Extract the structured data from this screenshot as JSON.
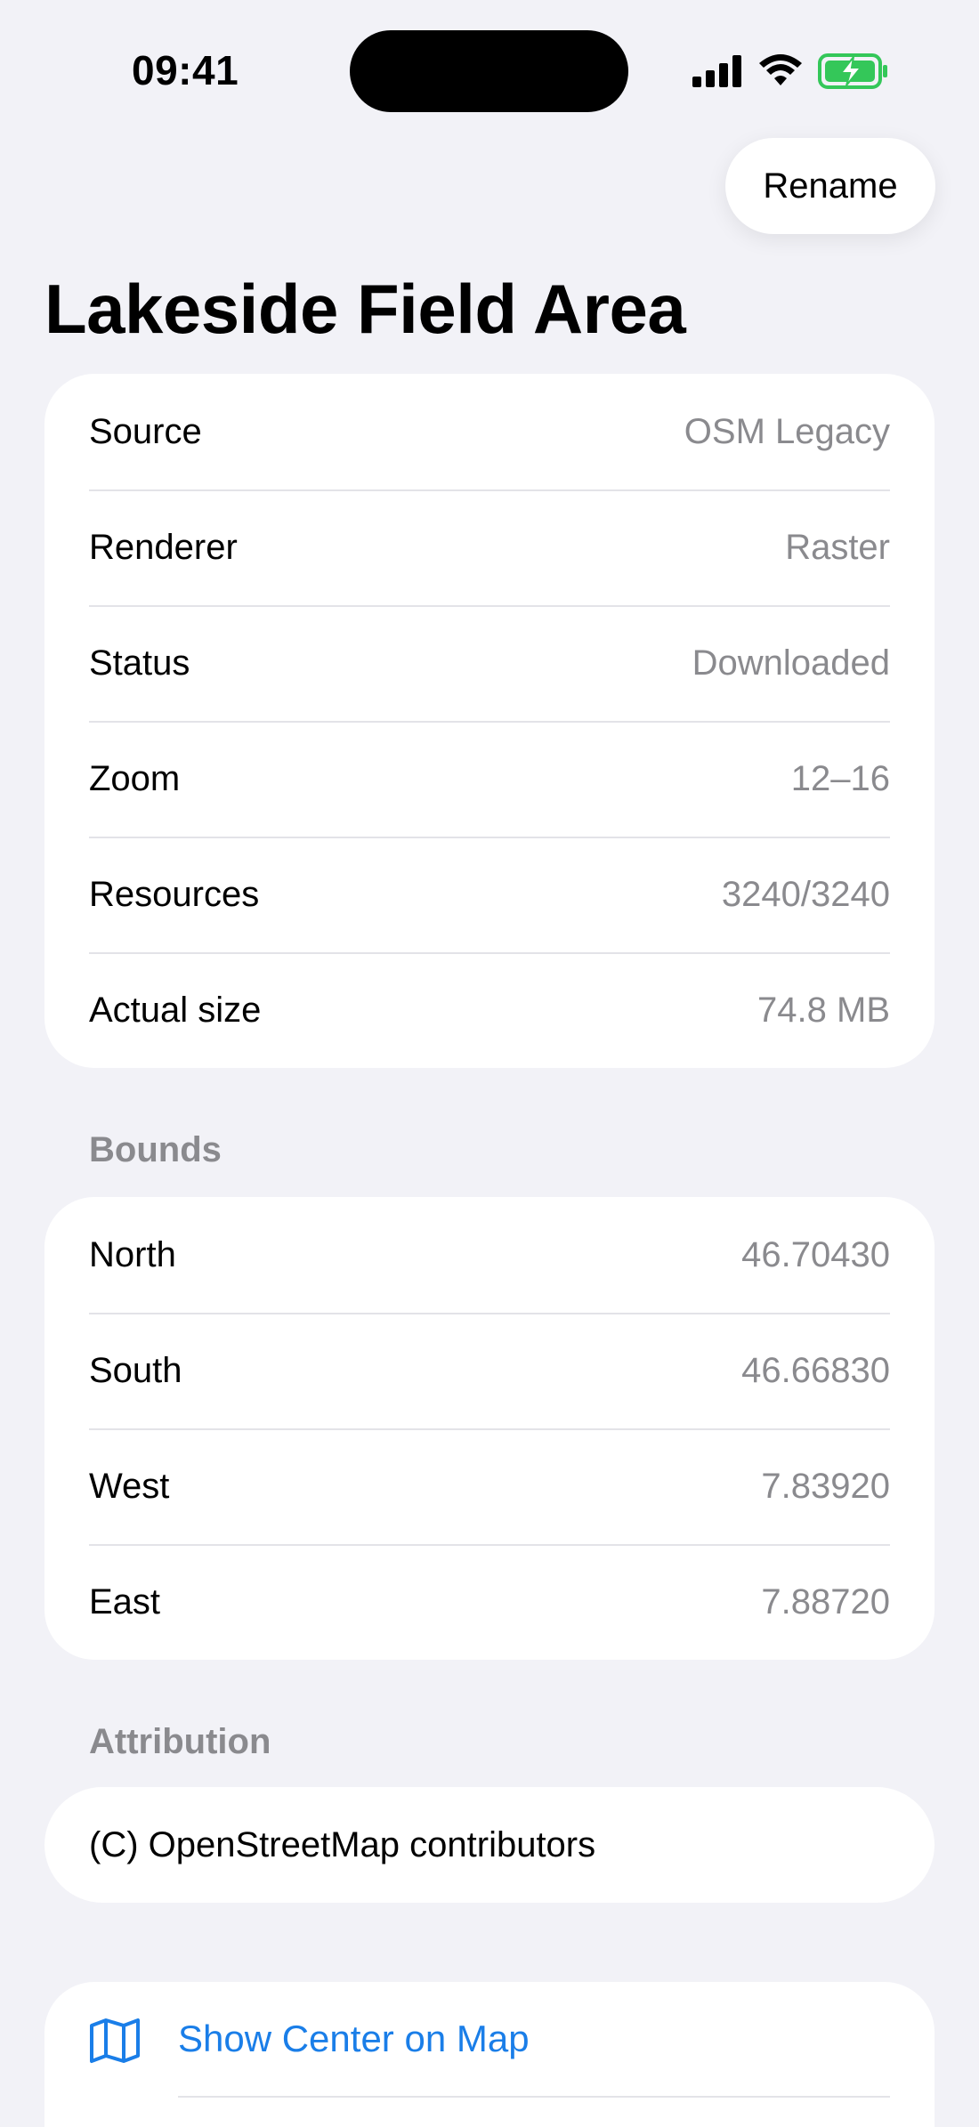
{
  "status_bar": {
    "time": "09:41",
    "icons": [
      "cellular-signal-icon",
      "wifi-icon",
      "battery-charging-icon"
    ]
  },
  "header": {
    "rename_label": "Rename",
    "title": "Lakeside Field Area"
  },
  "details": [
    {
      "label": "Source",
      "value": "OSM Legacy"
    },
    {
      "label": "Renderer",
      "value": "Raster"
    },
    {
      "label": "Status",
      "value": "Downloaded"
    },
    {
      "label": "Zoom",
      "value": "12–16"
    },
    {
      "label": "Resources",
      "value": "3240/3240"
    },
    {
      "label": "Actual size",
      "value": "74.8 MB"
    }
  ],
  "bounds": {
    "header": "Bounds",
    "rows": [
      {
        "label": "North",
        "value": "46.70430"
      },
      {
        "label": "South",
        "value": "46.66830"
      },
      {
        "label": "West",
        "value": "7.83920"
      },
      {
        "label": "East",
        "value": "7.88720"
      }
    ]
  },
  "attribution": {
    "header": "Attribution",
    "text": "(C) OpenStreetMap contributors"
  },
  "actions": {
    "show_center_label": "Show Center on Map",
    "show_center_icon": "map-icon"
  },
  "colors": {
    "background": "#f2f2f7",
    "accent": "#1a7ee8",
    "secondary_text": "#8a8a8e",
    "battery_green": "#34c759"
  }
}
